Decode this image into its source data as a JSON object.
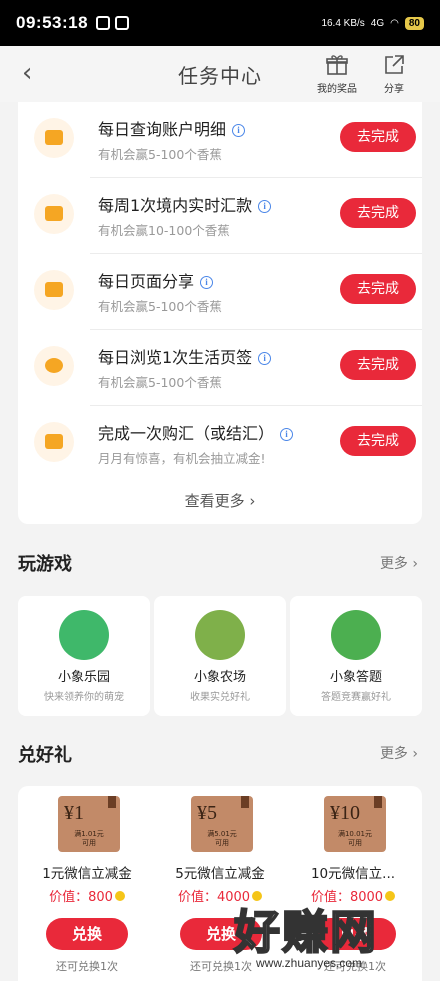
{
  "status": {
    "time": "09:53:18",
    "net_speed": "16.4 KB/s",
    "network": "4G",
    "battery": "80"
  },
  "nav": {
    "title": "任务中心",
    "my_prizes": "我的奖品",
    "share": "分享"
  },
  "tasks": [
    {
      "title": "每日查询账户明细",
      "sub": "有机会赢5-100个香蕉",
      "btn": "去完成"
    },
    {
      "title": "每周1次境内实时汇款",
      "sub": "有机会赢10-100个香蕉",
      "btn": "去完成"
    },
    {
      "title": "每日页面分享",
      "sub": "有机会赢5-100个香蕉",
      "btn": "去完成"
    },
    {
      "title": "每日浏览1次生活页签",
      "sub": "有机会赢5-100个香蕉",
      "btn": "去完成"
    },
    {
      "title": "完成一次购汇（或结汇）",
      "sub": "月月有惊喜，有机会抽立减金!",
      "btn": "去完成"
    }
  ],
  "see_more": "查看更多",
  "games_section": {
    "title": "玩游戏",
    "more": "更多"
  },
  "games": [
    {
      "name": "小象乐园",
      "sub": "快来领养你的萌宠",
      "color": "#3fb86a"
    },
    {
      "name": "小象农场",
      "sub": "收果实兑好礼",
      "color": "#7fb04a"
    },
    {
      "name": "小象答题",
      "sub": "答题竞赛赢好礼",
      "color": "#4caf50"
    }
  ],
  "gifts_section": {
    "title": "兑好礼",
    "more": "更多"
  },
  "gifts": [
    {
      "amount": "¥1",
      "cond": "满1.01元\n可用",
      "name": "1元微信立减金",
      "value": "价值：800",
      "btn": "兑换",
      "left": "还可兑换1次"
    },
    {
      "amount": "¥5",
      "cond": "满5.01元\n可用",
      "name": "5元微信立减金",
      "value": "价值：4000",
      "btn": "兑换",
      "left": "还可兑换1次"
    },
    {
      "amount": "¥10",
      "cond": "满10.01元\n可用",
      "name": "10元微信立...",
      "value": "价值：8000",
      "btn": "兑换",
      "left": "还可兑换1次"
    }
  ],
  "watermark": {
    "text": "好赚网",
    "url": "www.zhuanyes.com"
  },
  "colors": {
    "accent_red": "#e9293a",
    "icon_orange": "#f5a623",
    "info_blue": "#4a86e8"
  }
}
